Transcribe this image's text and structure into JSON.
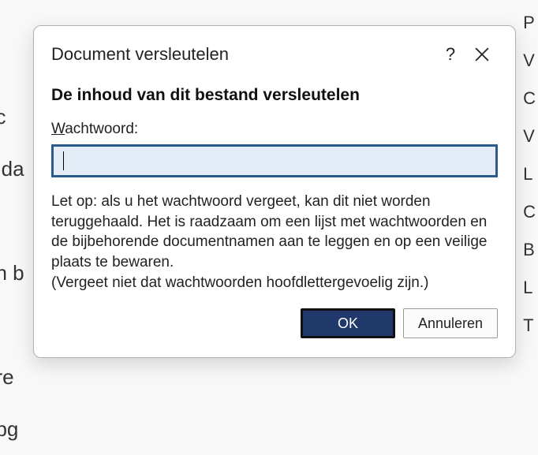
{
  "background": {
    "left_fragments": [
      "ec",
      "e da",
      "an b",
      "ere",
      "opg"
    ],
    "right_fragments": [
      "P",
      "V",
      "C",
      "V",
      "L",
      "C",
      "",
      "B",
      "L",
      "T"
    ]
  },
  "dialog": {
    "title": "Document versleutelen",
    "heading": "De inhoud van dit bestand versleutelen",
    "password_label_underline": "W",
    "password_label_rest": "achtwoord:",
    "password_value": "",
    "warning_text": "Let op: als u het wachtwoord vergeet, kan dit niet worden teruggehaald. Het is raadzaam om een lijst met wachtwoorden en de bijbehorende documentnamen aan te leggen en op een veilige plaats te bewaren.",
    "warning_note": "(Vergeet niet dat wachtwoorden hoofdlettergevoelig zijn.)",
    "ok_label": "OK",
    "cancel_label": "Annuleren",
    "help_label": "?"
  }
}
